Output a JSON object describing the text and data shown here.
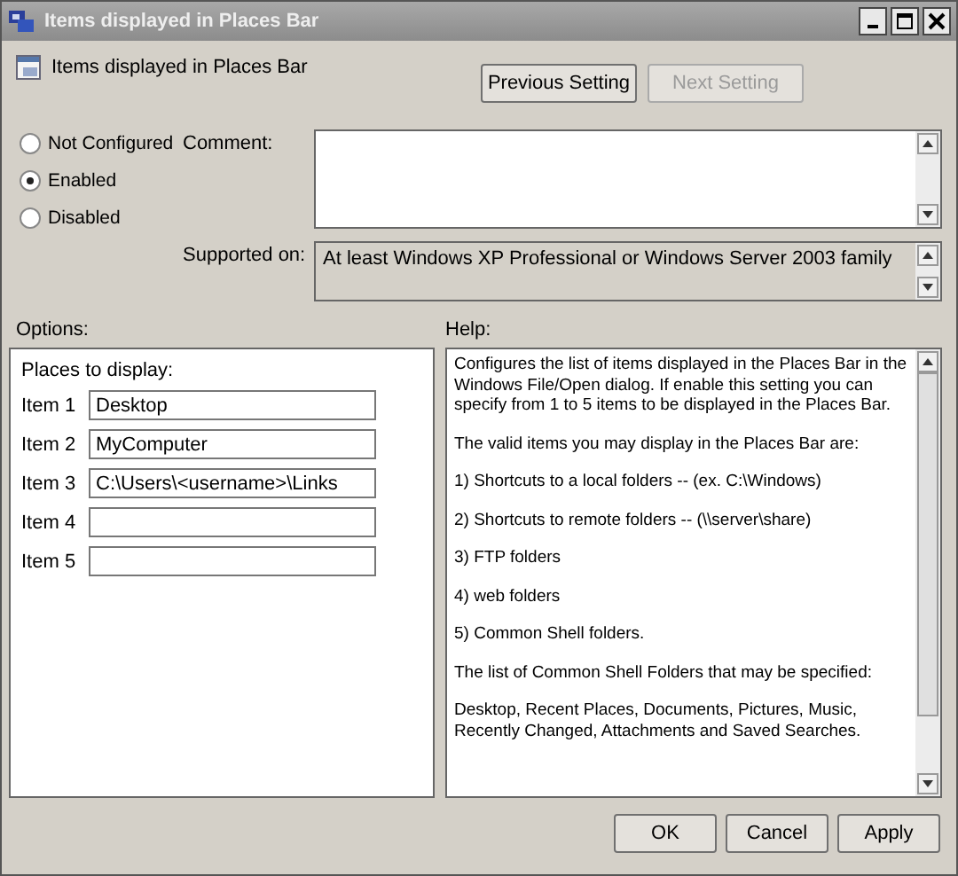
{
  "window": {
    "title": "Items displayed in Places Bar"
  },
  "header": {
    "title": "Items displayed in Places Bar",
    "buttons": [
      {
        "label": "Previous Setting",
        "disabled": false
      },
      {
        "label": "Next Setting",
        "disabled": true
      }
    ]
  },
  "states": [
    {
      "label": "Not Configured",
      "selected": false
    },
    {
      "label": "Enabled",
      "selected": true
    },
    {
      "label": "Disabled",
      "selected": false
    }
  ],
  "comment": {
    "label": "Comment:"
  },
  "supported_on": {
    "label": "Supported on:",
    "value": "At least Windows XP Professional or Windows Server 2003 family"
  },
  "options": {
    "label": "Options:",
    "heading": "Places to display:",
    "items": [
      {
        "label": "Item 1",
        "value": "Desktop"
      },
      {
        "label": "Item 2",
        "value": "MyComputer"
      },
      {
        "label": "Item 3",
        "value": "C:\\Users\\<username>\\Links"
      },
      {
        "label": "Item 4"
      },
      {
        "label": "Item 5"
      }
    ]
  },
  "help": {
    "label": "Help:",
    "paragraphs": [
      "Configures the list of items displayed in the Places Bar in the Windows File/Open dialog. If enable this setting you can specify from 1 to 5 items to be displayed in the Places Bar.",
      "The valid items you may display in the Places Bar are:",
      "1) Shortcuts to a local folders -- (ex. C:\\Windows)",
      "2) Shortcuts to remote folders -- (\\\\server\\share)",
      "3) FTP folders",
      "4) web folders",
      "5) Common Shell folders.",
      "The list of Common Shell Folders that may be specified:",
      "Desktop, Recent Places, Documents, Pictures, Music, Recently Changed, Attachments and Saved Searches."
    ]
  },
  "buttons": [
    {
      "label": "OK"
    },
    {
      "label": "Cancel"
    },
    {
      "label": "Apply"
    }
  ]
}
